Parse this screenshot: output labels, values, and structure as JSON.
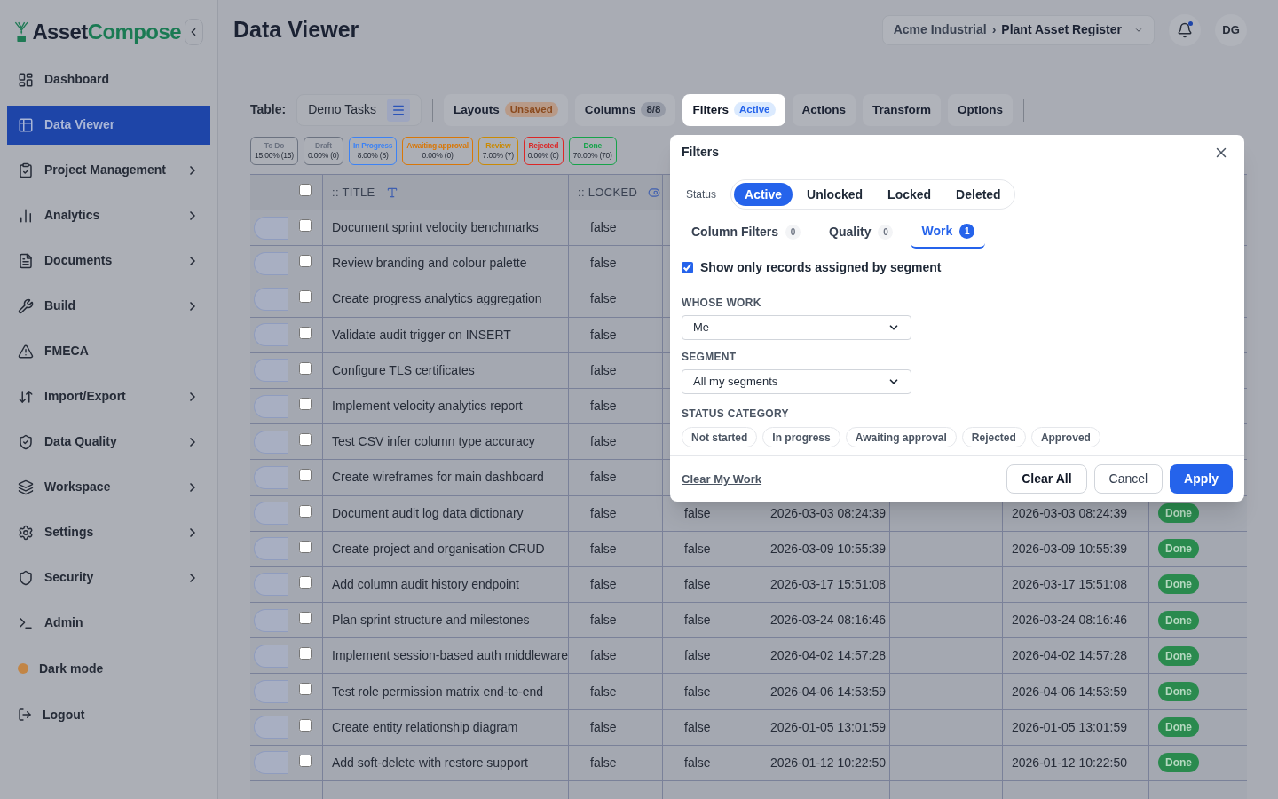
{
  "sidebar": {
    "brand": {
      "first": "Asset",
      "second": "Compose"
    },
    "items": [
      {
        "label": "Dashboard",
        "selected": false,
        "expandable": false
      },
      {
        "label": "Data Viewer",
        "selected": true,
        "expandable": false
      },
      {
        "label": "Project Management",
        "selected": false,
        "expandable": true
      },
      {
        "label": "Analytics",
        "selected": false,
        "expandable": true
      },
      {
        "label": "Documents",
        "selected": false,
        "expandable": true
      },
      {
        "label": "Build",
        "selected": false,
        "expandable": true
      },
      {
        "label": "FMECA",
        "selected": false,
        "expandable": false
      },
      {
        "label": "Import/Export",
        "selected": false,
        "expandable": true
      },
      {
        "label": "Data Quality",
        "selected": false,
        "expandable": true
      },
      {
        "label": "Workspace",
        "selected": false,
        "expandable": true
      },
      {
        "label": "Settings",
        "selected": false,
        "expandable": true
      },
      {
        "label": "Security",
        "selected": false,
        "expandable": true
      },
      {
        "label": "Admin",
        "selected": false,
        "expandable": false
      }
    ],
    "dark_mode": {
      "label": "Dark mode",
      "on": false
    },
    "logout": "Logout"
  },
  "header": {
    "title": "Data Viewer",
    "breadcrumb": {
      "org": "Acme Industrial",
      "separator": "›",
      "project": "Plant Asset Register"
    },
    "notifications": true,
    "avatar": "DG"
  },
  "toolbar": {
    "table_label": "Table:",
    "table_name": "Demo Tasks",
    "items": [
      {
        "label": "Layouts",
        "badge": "Unsaved",
        "selected": false
      },
      {
        "label": "Columns",
        "badge": "8/8",
        "selected": false
      },
      {
        "label": "Filters",
        "badge": "Active",
        "selected": true
      },
      {
        "label": "Actions",
        "selected": false
      },
      {
        "label": "Transform",
        "selected": false
      },
      {
        "label": "Options",
        "selected": false
      }
    ]
  },
  "status_chips": [
    {
      "label": "To Do",
      "value": "15.00% (15)",
      "color": "#6b7280"
    },
    {
      "label": "Draft",
      "value": "0.00% (0)",
      "color": "#6b7280"
    },
    {
      "label": "In Progress",
      "value": "8.00% (8)",
      "color": "#3b82f6"
    },
    {
      "label": "Awaiting approval",
      "value": "0.00% (0)",
      "color": "#d97706"
    },
    {
      "label": "Review",
      "value": "7.00% (7)",
      "color": "#ca8a04"
    },
    {
      "label": "Rejected",
      "value": "0.00% (0)",
      "color": "#dc2626"
    },
    {
      "label": "Done",
      "value": "70.00% (70)",
      "color": "#16a34a"
    }
  ],
  "table": {
    "select_all": {
      "checked": false
    },
    "columns": [
      {
        "label": ":: TITLE",
        "kind": "text"
      },
      {
        "label": ":: LOCKED",
        "kind": "boolean"
      }
    ],
    "rows": [
      {
        "checked": false,
        "title": "Document sprint velocity benchmarks",
        "locked": "false"
      },
      {
        "checked": false,
        "title": "Review branding and colour palette",
        "locked": "false"
      },
      {
        "checked": false,
        "title": "Create progress analytics aggregation",
        "locked": "false"
      },
      {
        "checked": false,
        "title": "Validate audit trigger on INSERT",
        "locked": "false"
      },
      {
        "checked": false,
        "title": "Configure TLS certificates",
        "locked": "false"
      },
      {
        "checked": false,
        "title": "Implement velocity analytics report",
        "locked": "false"
      },
      {
        "checked": false,
        "title": "Test CSV infer column type accuracy",
        "locked": "false"
      },
      {
        "checked": false,
        "title": "Create wireframes for main dashboard",
        "locked": "false"
      },
      {
        "checked": false,
        "title": "Document audit log data dictionary",
        "locked": "false",
        "column_5": "false",
        "column_6": "2026-03-03 08:24:39",
        "column_8": "2026-03-03 08:24:39",
        "status": "Done"
      },
      {
        "checked": false,
        "title": "Create project and organisation CRUD",
        "locked": "false",
        "column_5": "false",
        "column_6": "2026-03-09 10:55:39",
        "column_8": "2026-03-09 10:55:39",
        "status": "Done"
      },
      {
        "checked": false,
        "title": "Add column audit history endpoint",
        "locked": "false",
        "column_5": "false",
        "column_6": "2026-03-17 15:51:08",
        "column_8": "2026-03-17 15:51:08",
        "status": "Done"
      },
      {
        "checked": false,
        "title": "Plan sprint structure and milestones",
        "locked": "false",
        "column_5": "false",
        "column_6": "2026-03-24 08:16:46",
        "column_8": "2026-03-24 08:16:46",
        "status": "Done"
      },
      {
        "checked": false,
        "title": "Implement session-based auth middleware",
        "locked": "false",
        "column_5": "false",
        "column_6": "2026-04-02 14:57:28",
        "column_8": "2026-04-02 14:57:28",
        "status": "Done"
      },
      {
        "checked": false,
        "title": "Test role permission matrix end-to-end",
        "locked": "false",
        "column_5": "false",
        "column_6": "2026-04-06 14:53:59",
        "column_8": "2026-04-06 14:53:59",
        "status": "Done"
      },
      {
        "checked": false,
        "title": "Create entity relationship diagram",
        "locked": "false",
        "column_5": "false",
        "column_6": "2026-01-05 13:01:59",
        "column_8": "2026-01-05 13:01:59",
        "status": "Done"
      },
      {
        "checked": false,
        "title": "Add soft-delete with restore support",
        "locked": "false",
        "column_5": "false",
        "column_6": "2026-01-12 10:22:50",
        "column_8": "2026-01-12 10:22:50",
        "status": "Done"
      }
    ]
  },
  "filters_dialog": {
    "title": "Filters",
    "status_label": "Status",
    "status_options": [
      {
        "label": "Active",
        "selected": true
      },
      {
        "label": "Unlocked",
        "selected": false
      },
      {
        "label": "Locked",
        "selected": false
      },
      {
        "label": "Deleted",
        "selected": false
      }
    ],
    "tabs": [
      {
        "label": "Column Filters",
        "count": "0",
        "selected": false
      },
      {
        "label": "Quality",
        "count": "0",
        "selected": false
      },
      {
        "label": "Work",
        "count": "1",
        "selected": true
      }
    ],
    "assigned_only": {
      "label": "Show only records assigned by segment",
      "checked": true
    },
    "whose_work": {
      "label": "WHOSE WORK",
      "value": "Me"
    },
    "segment": {
      "label": "SEGMENT",
      "value": "All my segments"
    },
    "status_category": {
      "label": "STATUS CATEGORY",
      "options": [
        {
          "label": "Not started",
          "selected": false
        },
        {
          "label": "In progress",
          "selected": false
        },
        {
          "label": "Awaiting approval",
          "selected": false
        },
        {
          "label": "Rejected",
          "selected": false
        },
        {
          "label": "Approved",
          "selected": false
        }
      ]
    },
    "clear_link": "Clear My Work",
    "buttons": [
      {
        "label": "Clear All",
        "kind": "secondary"
      },
      {
        "label": "Cancel",
        "kind": "plain"
      },
      {
        "label": "Apply",
        "kind": "primary"
      }
    ]
  }
}
